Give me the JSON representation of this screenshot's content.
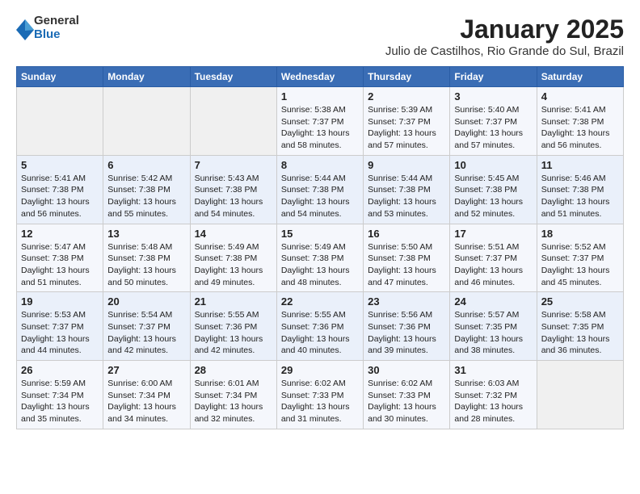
{
  "logo": {
    "general": "General",
    "blue": "Blue"
  },
  "title": "January 2025",
  "subtitle": "Julio de Castilhos, Rio Grande do Sul, Brazil",
  "weekdays": [
    "Sunday",
    "Monday",
    "Tuesday",
    "Wednesday",
    "Thursday",
    "Friday",
    "Saturday"
  ],
  "weeks": [
    [
      {
        "day": "",
        "content": ""
      },
      {
        "day": "",
        "content": ""
      },
      {
        "day": "",
        "content": ""
      },
      {
        "day": "1",
        "content": "Sunrise: 5:38 AM\nSunset: 7:37 PM\nDaylight: 13 hours\nand 58 minutes."
      },
      {
        "day": "2",
        "content": "Sunrise: 5:39 AM\nSunset: 7:37 PM\nDaylight: 13 hours\nand 57 minutes."
      },
      {
        "day": "3",
        "content": "Sunrise: 5:40 AM\nSunset: 7:37 PM\nDaylight: 13 hours\nand 57 minutes."
      },
      {
        "day": "4",
        "content": "Sunrise: 5:41 AM\nSunset: 7:38 PM\nDaylight: 13 hours\nand 56 minutes."
      }
    ],
    [
      {
        "day": "5",
        "content": "Sunrise: 5:41 AM\nSunset: 7:38 PM\nDaylight: 13 hours\nand 56 minutes."
      },
      {
        "day": "6",
        "content": "Sunrise: 5:42 AM\nSunset: 7:38 PM\nDaylight: 13 hours\nand 55 minutes."
      },
      {
        "day": "7",
        "content": "Sunrise: 5:43 AM\nSunset: 7:38 PM\nDaylight: 13 hours\nand 54 minutes."
      },
      {
        "day": "8",
        "content": "Sunrise: 5:44 AM\nSunset: 7:38 PM\nDaylight: 13 hours\nand 54 minutes."
      },
      {
        "day": "9",
        "content": "Sunrise: 5:44 AM\nSunset: 7:38 PM\nDaylight: 13 hours\nand 53 minutes."
      },
      {
        "day": "10",
        "content": "Sunrise: 5:45 AM\nSunset: 7:38 PM\nDaylight: 13 hours\nand 52 minutes."
      },
      {
        "day": "11",
        "content": "Sunrise: 5:46 AM\nSunset: 7:38 PM\nDaylight: 13 hours\nand 51 minutes."
      }
    ],
    [
      {
        "day": "12",
        "content": "Sunrise: 5:47 AM\nSunset: 7:38 PM\nDaylight: 13 hours\nand 51 minutes."
      },
      {
        "day": "13",
        "content": "Sunrise: 5:48 AM\nSunset: 7:38 PM\nDaylight: 13 hours\nand 50 minutes."
      },
      {
        "day": "14",
        "content": "Sunrise: 5:49 AM\nSunset: 7:38 PM\nDaylight: 13 hours\nand 49 minutes."
      },
      {
        "day": "15",
        "content": "Sunrise: 5:49 AM\nSunset: 7:38 PM\nDaylight: 13 hours\nand 48 minutes."
      },
      {
        "day": "16",
        "content": "Sunrise: 5:50 AM\nSunset: 7:38 PM\nDaylight: 13 hours\nand 47 minutes."
      },
      {
        "day": "17",
        "content": "Sunrise: 5:51 AM\nSunset: 7:37 PM\nDaylight: 13 hours\nand 46 minutes."
      },
      {
        "day": "18",
        "content": "Sunrise: 5:52 AM\nSunset: 7:37 PM\nDaylight: 13 hours\nand 45 minutes."
      }
    ],
    [
      {
        "day": "19",
        "content": "Sunrise: 5:53 AM\nSunset: 7:37 PM\nDaylight: 13 hours\nand 44 minutes."
      },
      {
        "day": "20",
        "content": "Sunrise: 5:54 AM\nSunset: 7:37 PM\nDaylight: 13 hours\nand 42 minutes."
      },
      {
        "day": "21",
        "content": "Sunrise: 5:55 AM\nSunset: 7:36 PM\nDaylight: 13 hours\nand 42 minutes."
      },
      {
        "day": "22",
        "content": "Sunrise: 5:55 AM\nSunset: 7:36 PM\nDaylight: 13 hours\nand 40 minutes."
      },
      {
        "day": "23",
        "content": "Sunrise: 5:56 AM\nSunset: 7:36 PM\nDaylight: 13 hours\nand 39 minutes."
      },
      {
        "day": "24",
        "content": "Sunrise: 5:57 AM\nSunset: 7:35 PM\nDaylight: 13 hours\nand 38 minutes."
      },
      {
        "day": "25",
        "content": "Sunrise: 5:58 AM\nSunset: 7:35 PM\nDaylight: 13 hours\nand 36 minutes."
      }
    ],
    [
      {
        "day": "26",
        "content": "Sunrise: 5:59 AM\nSunset: 7:34 PM\nDaylight: 13 hours\nand 35 minutes."
      },
      {
        "day": "27",
        "content": "Sunrise: 6:00 AM\nSunset: 7:34 PM\nDaylight: 13 hours\nand 34 minutes."
      },
      {
        "day": "28",
        "content": "Sunrise: 6:01 AM\nSunset: 7:34 PM\nDaylight: 13 hours\nand 32 minutes."
      },
      {
        "day": "29",
        "content": "Sunrise: 6:02 AM\nSunset: 7:33 PM\nDaylight: 13 hours\nand 31 minutes."
      },
      {
        "day": "30",
        "content": "Sunrise: 6:02 AM\nSunset: 7:33 PM\nDaylight: 13 hours\nand 30 minutes."
      },
      {
        "day": "31",
        "content": "Sunrise: 6:03 AM\nSunset: 7:32 PM\nDaylight: 13 hours\nand 28 minutes."
      },
      {
        "day": "",
        "content": ""
      }
    ]
  ]
}
